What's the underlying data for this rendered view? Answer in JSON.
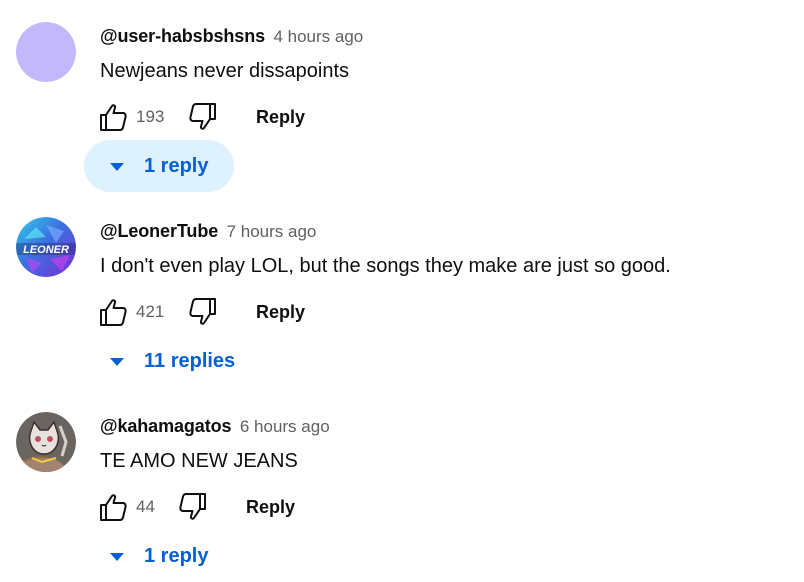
{
  "comments": [
    {
      "author": "@user-habsbshsns",
      "time": "4 hours ago",
      "text": "Newjeans never dissapoints",
      "likes": "193",
      "reply_label": "Reply",
      "replies_label": "1 reply",
      "avatar": "lavender-circle"
    },
    {
      "author": "@LeonerTube",
      "time": "7 hours ago",
      "text": "I don't even play LOL, but the songs they make are just so good.",
      "likes": "421",
      "reply_label": "Reply",
      "replies_label": "11 replies",
      "avatar": "leoner-logo",
      "avatar_text": "LEONER"
    },
    {
      "author": "@kahamagatos",
      "time": "6 hours ago",
      "text": "TE AMO NEW JEANS",
      "likes": "44",
      "reply_label": "Reply",
      "replies_label": "1 reply",
      "avatar": "cat-drawing"
    }
  ],
  "icons": {
    "like": "thumbs-up-icon",
    "dislike": "thumbs-down-icon",
    "expand": "caret-down-icon"
  },
  "colors": {
    "link_blue": "#065fd4",
    "meta_gray": "#606060",
    "hover_bg": "#def1ff",
    "avatar_lavender": "#c3b8fb"
  }
}
